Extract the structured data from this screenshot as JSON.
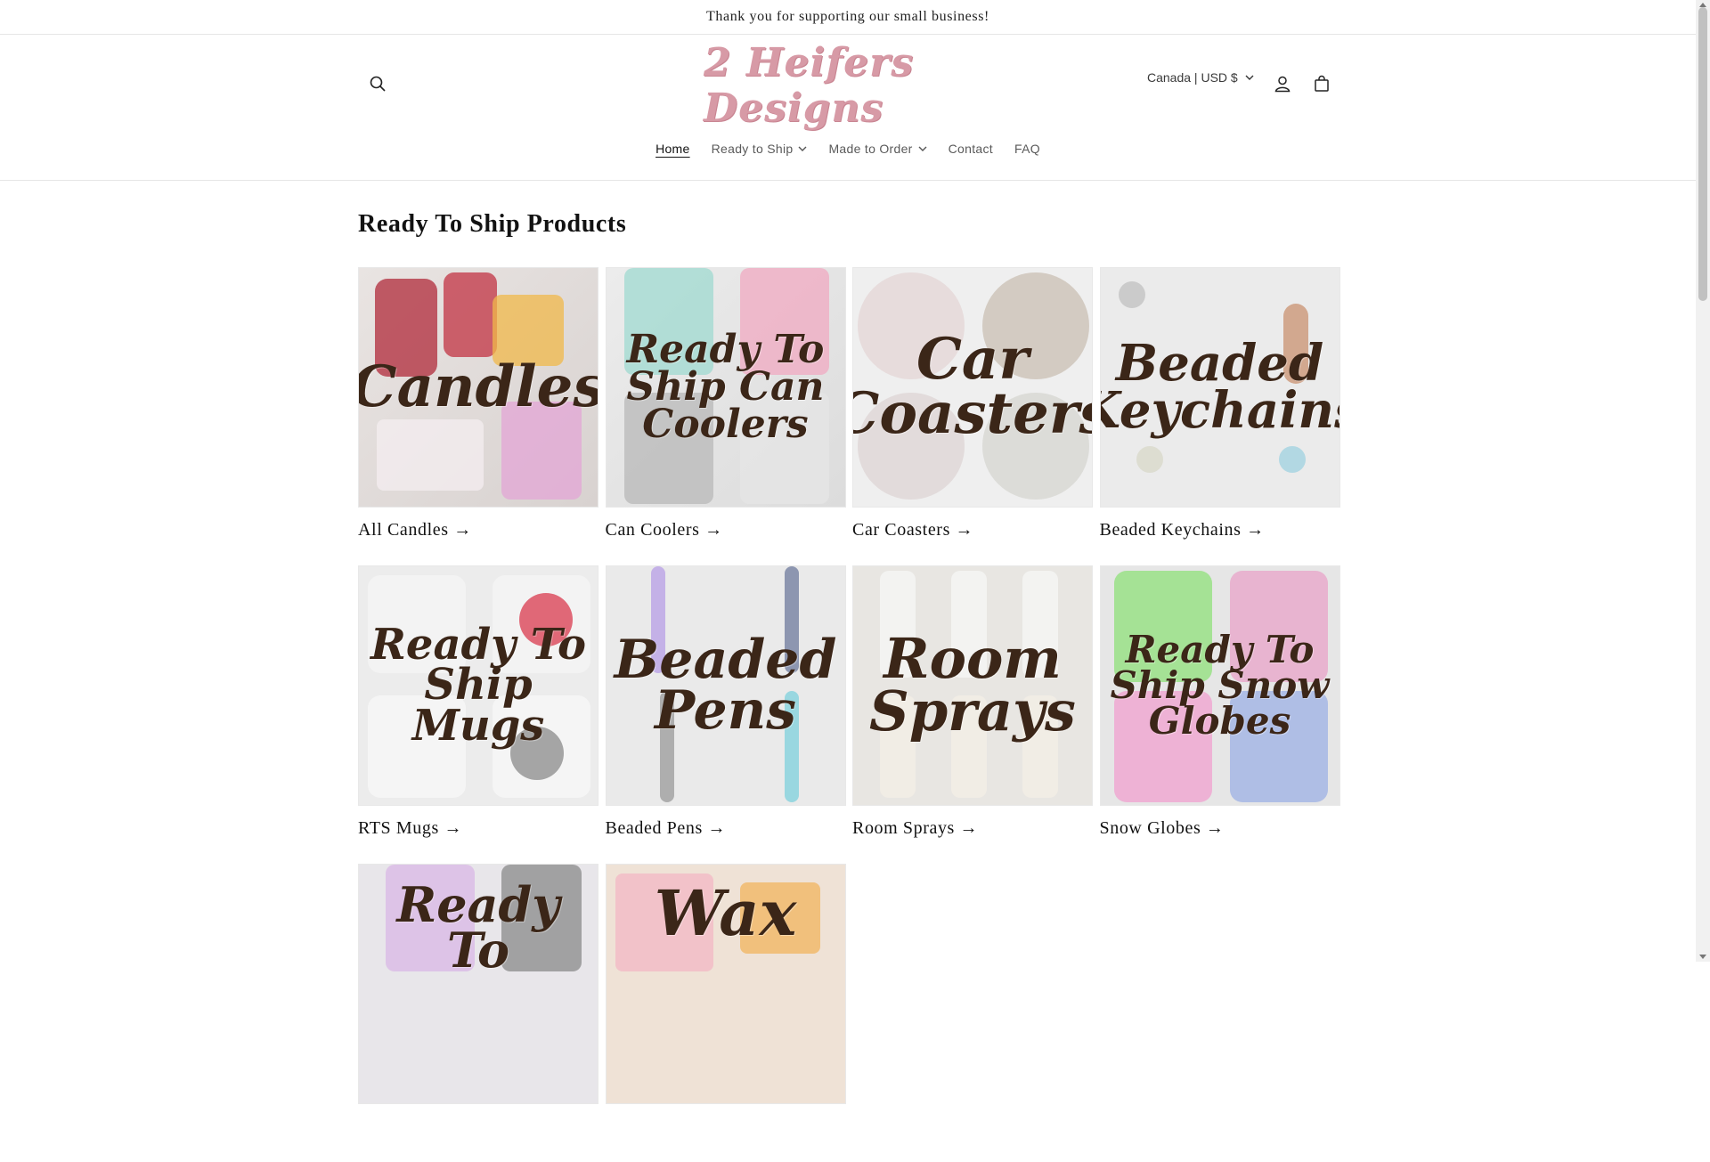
{
  "announcement": {
    "text": "Thank you for supporting our small business!"
  },
  "header": {
    "logo_text": "2 Heifers Designs",
    "locale": "Canada | USD $",
    "icons": [
      "search-icon",
      "account-icon",
      "cart-icon"
    ]
  },
  "nav": {
    "items": [
      {
        "label": "Home",
        "active": true,
        "dropdown": false
      },
      {
        "label": "Ready to Ship",
        "active": false,
        "dropdown": true
      },
      {
        "label": "Made to Order",
        "active": false,
        "dropdown": true
      },
      {
        "label": "Contact",
        "active": false,
        "dropdown": false
      },
      {
        "label": "FAQ",
        "active": false,
        "dropdown": false
      }
    ]
  },
  "section": {
    "title": "Ready To Ship Products",
    "collections": [
      {
        "title": "All Candles →",
        "overlay": "Candles"
      },
      {
        "title": "Can Coolers →",
        "overlay": "Ready To Ship Can Coolers"
      },
      {
        "title": "Car Coasters →",
        "overlay": "Car Coasters"
      },
      {
        "title": "Beaded Keychains →",
        "overlay": "Beaded Keychains"
      },
      {
        "title": "RTS Mugs →",
        "overlay": "Ready To Ship Mugs"
      },
      {
        "title": "Beaded Pens →",
        "overlay": "Beaded Pens"
      },
      {
        "title": "Room Sprays →",
        "overlay": "Room Sprays"
      },
      {
        "title": "Snow Globes →",
        "overlay": "Ready To Ship Snow Globes"
      },
      {
        "title": "",
        "overlay": "Ready To"
      },
      {
        "title": "",
        "overlay": "Wax"
      }
    ]
  },
  "colors": {
    "logo": "#d79aa6",
    "overlay_text": "#3b2618",
    "border": "#e6e6e6"
  }
}
